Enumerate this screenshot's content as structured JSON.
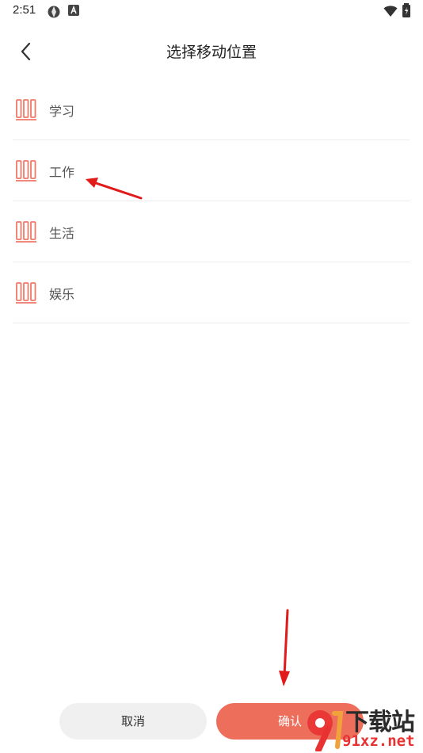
{
  "status_bar": {
    "time": "2:51"
  },
  "header": {
    "title": "选择移动位置"
  },
  "folders": [
    {
      "label": "学习"
    },
    {
      "label": "工作"
    },
    {
      "label": "生活"
    },
    {
      "label": "娱乐"
    }
  ],
  "buttons": {
    "cancel_label": "取消",
    "confirm_label": "确认"
  },
  "watermark": {
    "title": "下载站",
    "url": "91xz.net"
  },
  "colors": {
    "accent": "#ee6e5c",
    "folder_icon": "#f07a6a",
    "annotation_arrow": "#e11a1a"
  }
}
